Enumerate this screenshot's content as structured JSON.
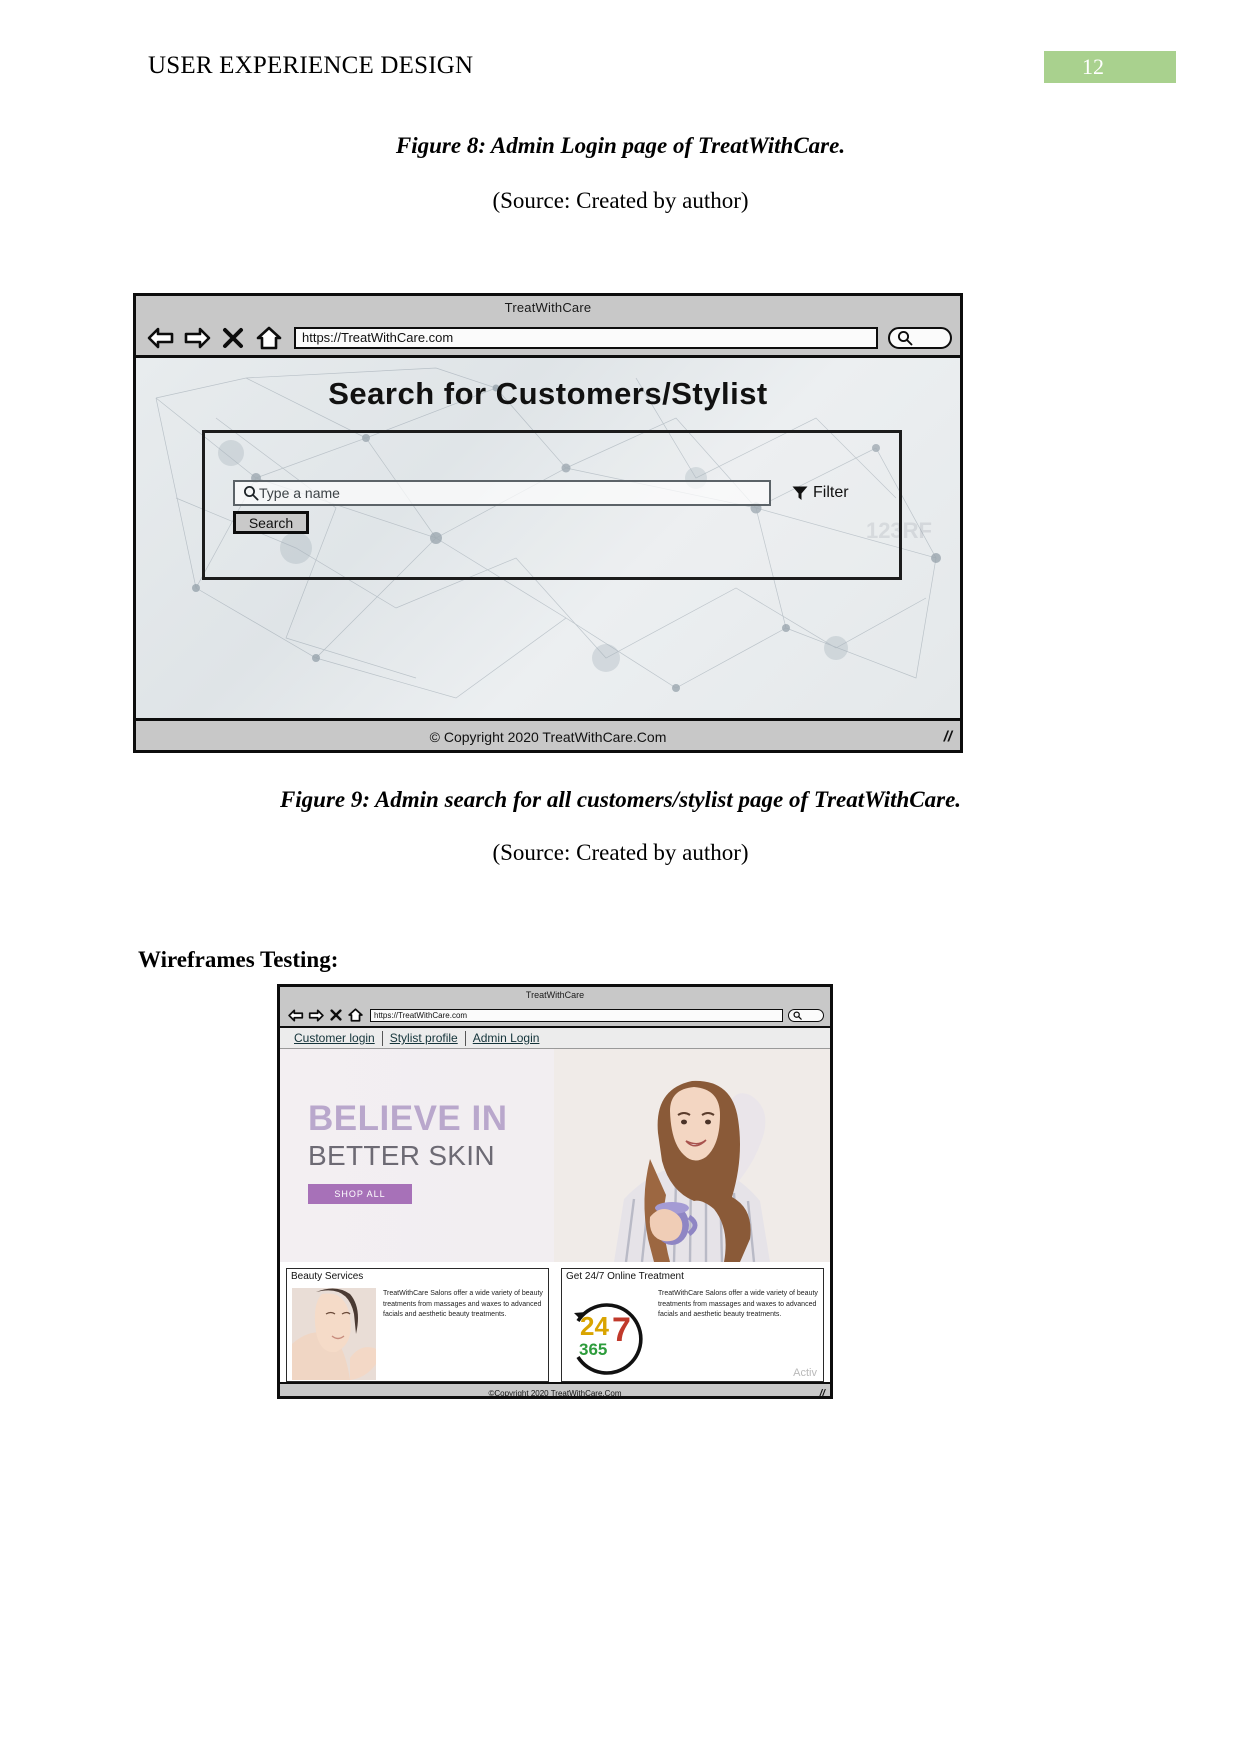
{
  "document": {
    "header_title": "USER EXPERIENCE DESIGN",
    "page_number": "12",
    "page_badge_color": "#a9d18e"
  },
  "captions": {
    "figure8": "Figure 8: Admin Login page of TreatWithCare.",
    "figure8_source": "(Source: Created by author)",
    "figure9": "Figure 9: Admin search for all customers/stylist page of TreatWithCare.",
    "figure9_source": "(Source: Created by author)",
    "section_heading": "Wireframes Testing:"
  },
  "wireframe_search": {
    "window_title": "TreatWithCare",
    "toolbar": {
      "back_icon": "back-arrow-icon",
      "forward_icon": "forward-arrow-icon",
      "stop_icon": "close-x-icon",
      "home_icon": "home-icon",
      "url_value": "https://TreatWithCare.com",
      "browser_search_icon": "search-icon"
    },
    "hero_title": "Search for Customers/Stylist",
    "search": {
      "icon": "magnifier-icon",
      "placeholder": "Type a name",
      "button_label": "Search",
      "filter_icon": "funnel-icon",
      "filter_label": "Filter"
    },
    "footer": "© Copyright 2020 TreatWithCare.Com",
    "resize_grip": "//"
  },
  "wireframe_home": {
    "window_title": "TreatWithCare",
    "toolbar": {
      "back_icon": "back-arrow-icon",
      "forward_icon": "forward-arrow-icon",
      "stop_icon": "close-x-icon",
      "home_icon": "home-icon",
      "url_value": "https://TreatWithCare.com",
      "browser_search_icon": "search-icon"
    },
    "nav_links": [
      "Customer login",
      "Stylist profile",
      "Admin Login"
    ],
    "hero": {
      "line1": "BELIEVE IN",
      "line2": "BETTER SKIN",
      "cta_label": "SHOP ALL",
      "line1_color": "#b9a7cc",
      "line2_color": "#6d6a74",
      "cta_color": "#a771b8"
    },
    "cards": [
      {
        "title": "Beauty Services",
        "body": "TreatWithCare Salons offer a wide variety of beauty treatments from massages and waxes to advanced facials and aesthetic beauty treatments.",
        "media": "woman-skincare-photo"
      },
      {
        "title": "Get 24/7 Online Treatment",
        "body": "TreatWithCare Salons offer a wide variety of beauty treatments from massages and waxes to advanced facials and aesthetic beauty treatments.",
        "media": "clock-24-7-365-graphic",
        "clock_numbers": [
          "24",
          "7",
          "365"
        ]
      }
    ],
    "footer": "©Copyright 2020 TreatWithCare.Com",
    "resize_grip": "//",
    "watermark": "Activ"
  }
}
